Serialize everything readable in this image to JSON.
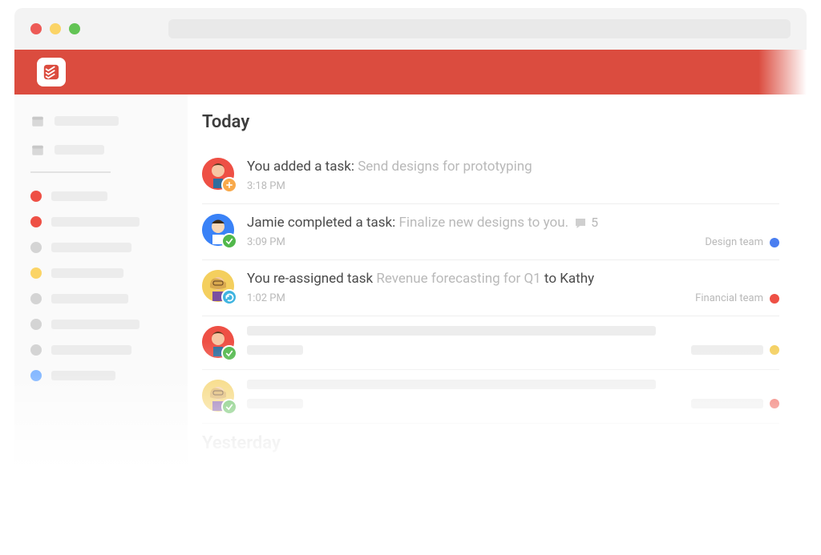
{
  "app": {
    "name": "Todoist"
  },
  "sections": {
    "today": "Today",
    "yesterday": "Yesterday"
  },
  "activity": [
    {
      "prefix": "You added a task: ",
      "detail": "Send designs for prototyping",
      "time": "3:18 PM",
      "avatar": "red",
      "badge": "add",
      "team": null,
      "comments": null
    },
    {
      "prefix": "Jamie completed a task: ",
      "detail": "Finalize new designs to you.",
      "time": "3:09 PM",
      "avatar": "blue",
      "badge": "check",
      "team": {
        "label": "Design team",
        "color": "blue"
      },
      "comments": 5
    },
    {
      "prefix": "You re-assigned task ",
      "detail": "Revenue forecasting for Q1",
      "suffix": " to Kathy",
      "time": "1:02 PM",
      "avatar": "yellow",
      "badge": "reassign",
      "team": {
        "label": "Financial team",
        "color": "red"
      },
      "comments": null
    }
  ],
  "placeholder_items": [
    {
      "avatar": "red",
      "badge": "check",
      "team_color": "yel"
    },
    {
      "avatar": "yellow",
      "badge": "check",
      "team_color": "red"
    }
  ],
  "sidebar": {
    "projects": [
      {
        "color": "red"
      },
      {
        "color": "red"
      },
      {
        "color": "grey"
      },
      {
        "color": "yel"
      },
      {
        "color": "grey"
      },
      {
        "color": "grey"
      },
      {
        "color": "grey"
      },
      {
        "color": "blue"
      }
    ]
  }
}
